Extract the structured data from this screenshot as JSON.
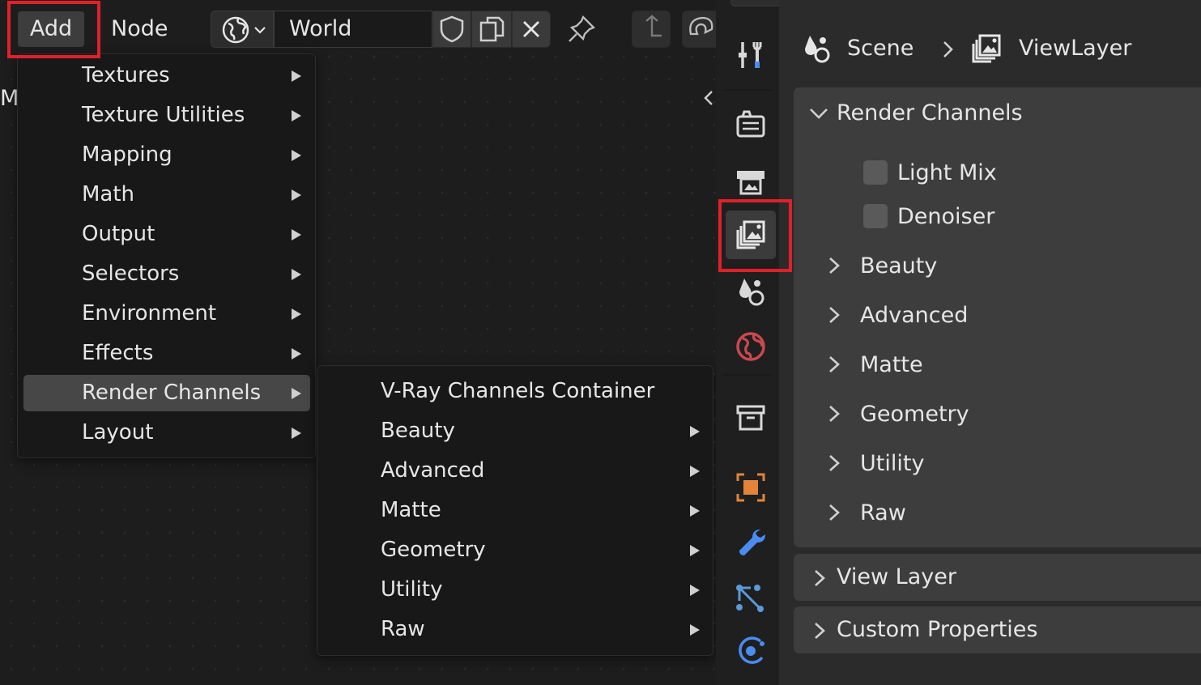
{
  "editor": {
    "menubar": {
      "add": "Add",
      "node": "Node"
    },
    "world_name": "World",
    "side_label": "M"
  },
  "add_menu": {
    "items": [
      {
        "label": "Textures"
      },
      {
        "label": "Texture Utilities"
      },
      {
        "label": "Mapping"
      },
      {
        "label": "Math"
      },
      {
        "label": "Output"
      },
      {
        "label": "Selectors"
      },
      {
        "label": "Environment"
      },
      {
        "label": "Effects"
      },
      {
        "label": "Render Channels"
      },
      {
        "label": "Layout"
      }
    ],
    "active_index": 8
  },
  "render_channels_menu": {
    "items": [
      {
        "label": "V-Ray Channels Container"
      },
      {
        "label": "Beauty"
      },
      {
        "label": "Advanced"
      },
      {
        "label": "Matte"
      },
      {
        "label": "Geometry"
      },
      {
        "label": "Utility"
      },
      {
        "label": "Raw"
      }
    ]
  },
  "properties": {
    "breadcrumb": {
      "scene": "Scene",
      "view_layer": "ViewLayer"
    },
    "render_channels": {
      "title": "Render Channels",
      "checkboxes": [
        {
          "label": "Light Mix",
          "checked": false
        },
        {
          "label": "Denoiser",
          "checked": false
        }
      ],
      "subpanels": [
        "Beauty",
        "Advanced",
        "Matte",
        "Geometry",
        "Utility",
        "Raw"
      ]
    },
    "view_layer_panel": "View Layer",
    "custom_properties_panel": "Custom Properties"
  },
  "tabs": [
    "tool-tab",
    "render-tab",
    "output-tab",
    "view-layer-tab",
    "scene-tab",
    "world-tab",
    "collection-tab",
    "object-tab",
    "modifier-tab",
    "particles-tab",
    "physics-tab"
  ],
  "colors": {
    "highlight": "#e0202a",
    "menu_bg": "#181818",
    "active_item": "#474747",
    "panel_bg": "#3d3d3d",
    "world_icon": "#c9494f",
    "object_icon": "#e3843a",
    "tool_blue": "#4a8cf0"
  }
}
